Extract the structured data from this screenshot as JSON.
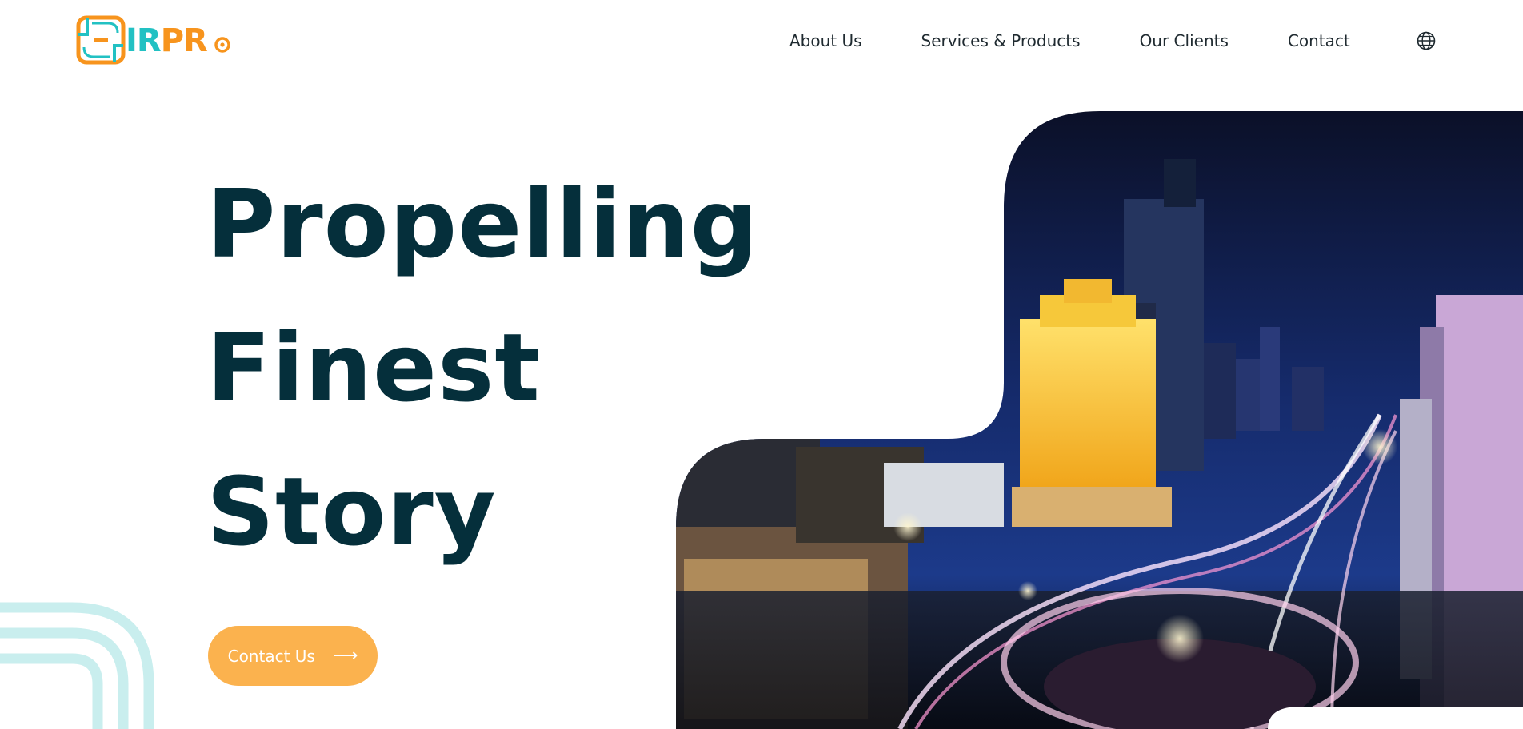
{
  "brand": {
    "logo_prefix": "IR",
    "logo_suffix": "PR",
    "colors": {
      "teal": "#22c1c3",
      "orange": "#f7941d",
      "navy": "#052f3b",
      "cta": "#fbb24e"
    }
  },
  "nav": {
    "items": [
      {
        "label": "About Us"
      },
      {
        "label": "Services & Products"
      },
      {
        "label": "Our Clients"
      },
      {
        "label": "Contact"
      }
    ],
    "language_icon": "globe-icon"
  },
  "hero": {
    "headline": [
      "Propelling",
      "Finest",
      "Story"
    ],
    "cta_label": "Contact Us",
    "cta_icon": "arrow-right-icon",
    "image_alt": "city-night-roundabout-photo"
  }
}
